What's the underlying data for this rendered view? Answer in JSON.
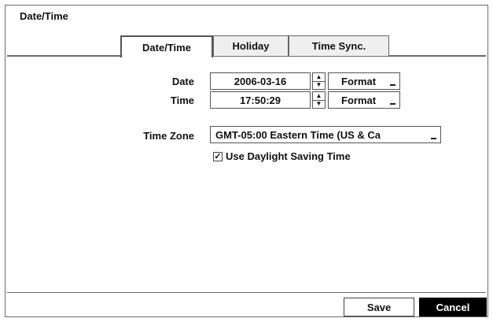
{
  "window": {
    "title": "Date/Time"
  },
  "tabs": [
    {
      "label": "Date/Time",
      "active": true
    },
    {
      "label": "Holiday",
      "active": false
    },
    {
      "label": "Time Sync.",
      "active": false
    }
  ],
  "form": {
    "date_label": "Date",
    "date_value": "2006-03-16",
    "date_format_label": "Format",
    "time_label": "Time",
    "time_value": "17:50:29",
    "time_format_label": "Format",
    "timezone_label": "Time Zone",
    "timezone_value": "GMT-05:00  Eastern Time (US & Ca",
    "dst_checked": true,
    "dst_label": "Use Daylight Saving Time"
  },
  "buttons": {
    "save": "Save",
    "cancel": "Cancel"
  }
}
